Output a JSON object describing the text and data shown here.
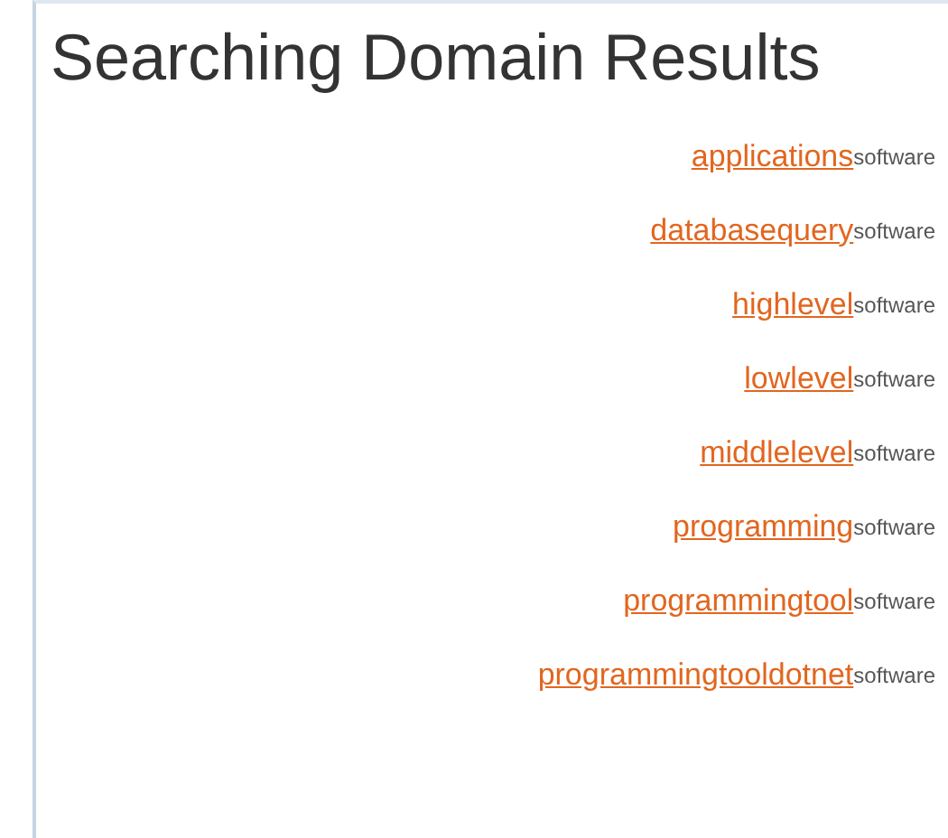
{
  "title": "Searching Domain Results",
  "results": [
    {
      "term": "applications",
      "category": "software"
    },
    {
      "term": "databasequery",
      "category": "software"
    },
    {
      "term": "highlevel",
      "category": "software"
    },
    {
      "term": "lowlevel",
      "category": "software"
    },
    {
      "term": "middlelevel",
      "category": "software"
    },
    {
      "term": "programming",
      "category": "software"
    },
    {
      "term": "programmingtool",
      "category": "software"
    },
    {
      "term": "programmingtooldotnet",
      "category": "software"
    }
  ]
}
